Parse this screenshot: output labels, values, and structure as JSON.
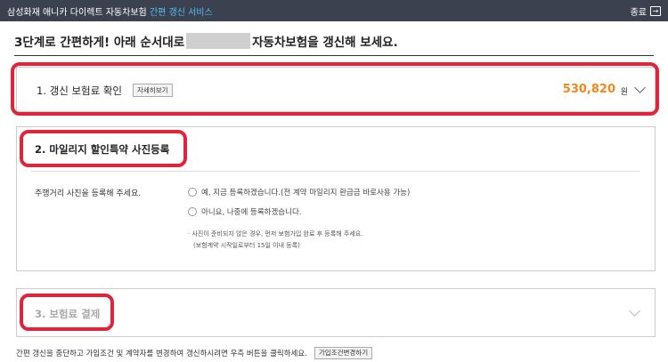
{
  "topbar": {
    "service_prefix": "삼성화재 애니카 다이렉트 자동차보험",
    "service_highlight": "간편 갱신 서비스",
    "close_label": "종료",
    "close_icon": "exit-icon"
  },
  "headline": {
    "text_before": "3단계로 간편하게! 아래 순서대로",
    "text_after": "자동차보험을 갱신해 보세요."
  },
  "step1": {
    "title": "1. 갱신 보험료 확인",
    "detail_button": "자세히보기",
    "amount": "530,820",
    "unit": "원"
  },
  "step2": {
    "title": "2. 마일리지 할인특약 사진등록",
    "question": "주행거리 사진을 등록해 주세요.",
    "options": [
      "예, 지금 등록하겠습니다.(전 계약 마일리지 환급금 바로사용 가능)",
      "아니요, 나중에 등록하겠습니다."
    ],
    "notes": [
      "· 사진이 준비되지 않은 경우, 먼저 보험가입 완료 후 등록해 주세요.",
      "(보험계약 시작일로부터 15일 이내 등록)"
    ]
  },
  "step3": {
    "title": "3. 보험료 결제"
  },
  "footer": {
    "text": "간편 갱신을 중단하고 가입조건 및 계약자를 변경하여 갱신하시려면 우측 버튼을 클릭하세요.",
    "button": "가입조건변경하기"
  },
  "colors": {
    "highlight_frame": "#e0243c",
    "amount": "#f08a1c",
    "topbar_bg": "#3c4150"
  }
}
